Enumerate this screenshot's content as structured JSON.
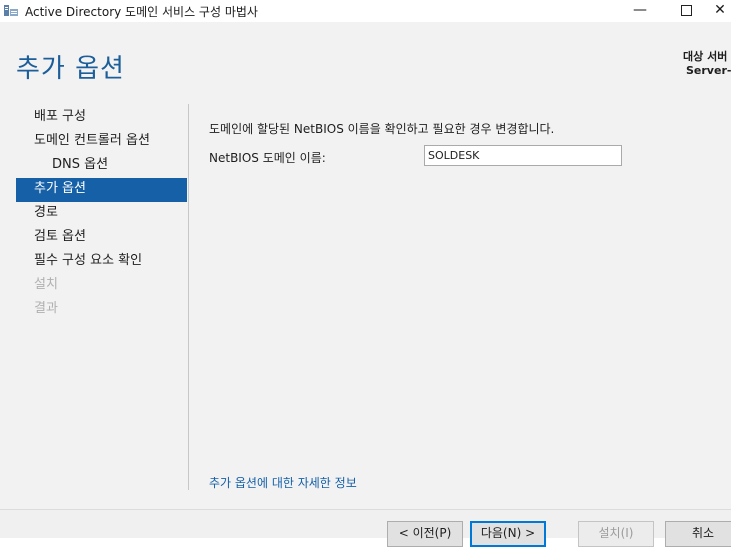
{
  "window": {
    "title": "Active Directory 도메인 서비스 구성 마법사",
    "minimize_glyph": "—",
    "close_glyph": "✕"
  },
  "page": {
    "title": "추가 옵션",
    "target_server_label": "대상 서버",
    "target_server_value": "Server-A"
  },
  "nav": {
    "items": [
      {
        "label": "배포 구성",
        "state": "normal"
      },
      {
        "label": "도메인 컨트롤러 옵션",
        "state": "normal"
      },
      {
        "label": "DNS 옵션",
        "state": "normal",
        "indent": true
      },
      {
        "label": "추가 옵션",
        "state": "active"
      },
      {
        "label": "경로",
        "state": "normal"
      },
      {
        "label": "검토 옵션",
        "state": "normal"
      },
      {
        "label": "필수 구성 요소 확인",
        "state": "normal"
      },
      {
        "label": "설치",
        "state": "disabled"
      },
      {
        "label": "결과",
        "state": "disabled"
      }
    ]
  },
  "content": {
    "description": "도메인에 할당된 NetBIOS 이름을 확인하고 필요한 경우 변경합니다.",
    "netbios_label": "NetBIOS 도메인 이름:",
    "netbios_value": "SOLDESK",
    "more_info_link": "추가 옵션에 대한 자세한 정보"
  },
  "buttons": {
    "prev": "< 이전(P)",
    "next": "다음(N) >",
    "install": "설치(I)",
    "cancel": "취소"
  },
  "colors": {
    "accent": "#1660a8",
    "title": "#1b5e9a",
    "disabled": "#b0b0b0"
  }
}
